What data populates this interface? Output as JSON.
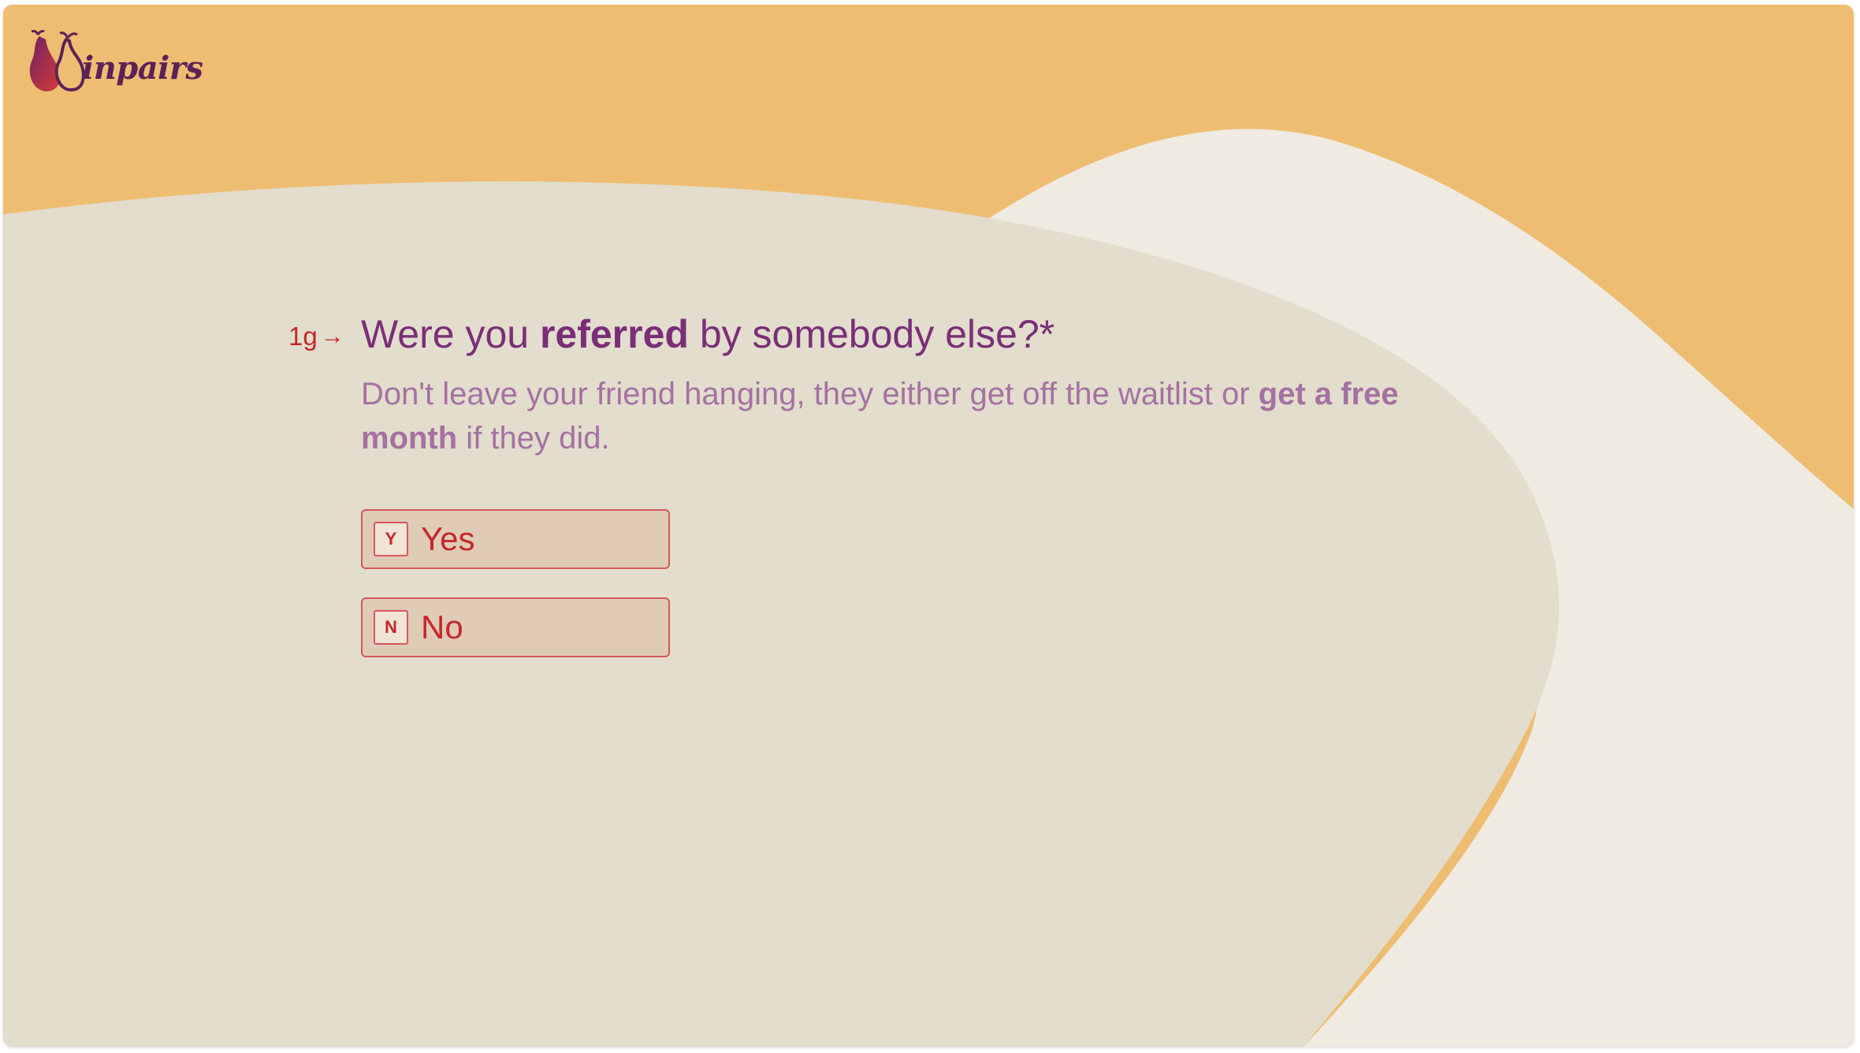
{
  "brand": {
    "logo_text": "inpairs",
    "logo_icon": "pear-icon"
  },
  "question": {
    "number": "1g",
    "arrow_icon": "arrow-right-icon",
    "title_before": "Were you ",
    "title_bold": "referred",
    "title_after": " by somebody else?*",
    "description_before": "Don't leave your friend hanging, they either get off the waitlist or ",
    "description_bold": "get a free month",
    "description_after": " if they did."
  },
  "choices": [
    {
      "key": "Y",
      "label": "Yes"
    },
    {
      "key": "N",
      "label": "No"
    }
  ],
  "colors": {
    "background": "#efbd72",
    "primary_text": "#7a2e78",
    "secondary_text": "#a571a2",
    "accent": "#c4282a",
    "choice_fill": "#e0cbb7"
  }
}
